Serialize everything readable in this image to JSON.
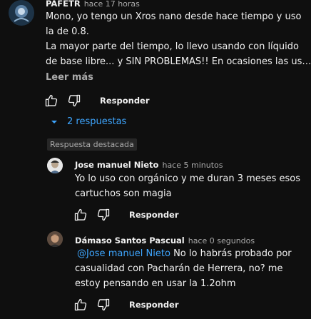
{
  "top_comment": {
    "author": "PAFETR",
    "time": "hace 17 horas",
    "lines": [
      "Mono, yo tengo un Xros nano desde hace tiempo y uso",
      "la de 0.8.",
      "La mayor parte del tiempo, lo llevo usando con líquido",
      "de base libre... y SIN PROBLEMAS!! En ocasiones las us…"
    ],
    "read_more": "Leer más",
    "reply_label": "Responder"
  },
  "replies_toggle": "2 respuestas",
  "highlight_badge": "Respuesta destacada",
  "replies": [
    {
      "author": "Jose manuel Nieto",
      "time": "hace 5 minutos",
      "lines": [
        "Yo lo uso con orgánico y me duran 3 meses esos",
        "cartuchos son magia"
      ],
      "reply_label": "Responder"
    },
    {
      "author": "Dámaso Santos Pascual",
      "time": "hace 0 segundos",
      "mention": "@Jose manuel Nieto",
      "line1_rest": "No lo habrás probado por",
      "lines": [
        "casualidad con Pacharán de Herrera, no? me",
        "estoy pensando en usar la 1.2ohm"
      ],
      "reply_label": "Responder"
    }
  ],
  "colors": {
    "background": "#0f0f0f",
    "text": "#f1f1f1",
    "secondary": "#aaaaaa",
    "link": "#3ea6ff"
  }
}
